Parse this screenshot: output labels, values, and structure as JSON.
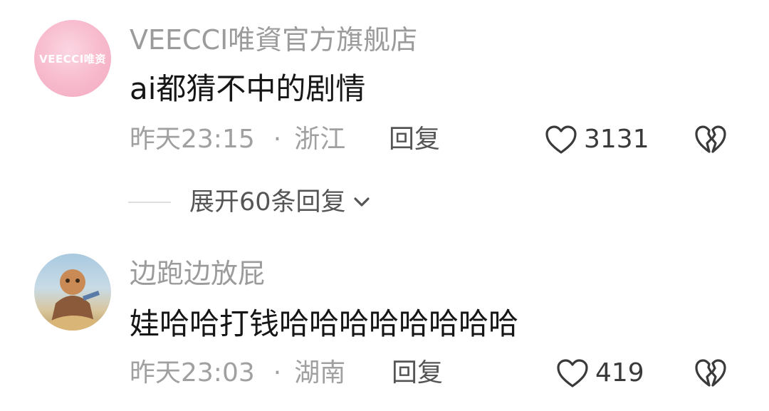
{
  "comments": [
    {
      "username": "VEECCI唯資官方旗舰店",
      "avatar_text": "VEECCI唯资",
      "text": "ai都猜不中的剧情",
      "time": "昨天23:15",
      "location": "浙江",
      "reply_label": "回复",
      "likes": "3131",
      "expand_label": "展开60条回复"
    },
    {
      "username": "边跑边放屁",
      "text": "娃哈哈打钱哈哈哈哈哈哈哈哈",
      "time": "昨天23:03",
      "location": "湖南",
      "reply_label": "回复",
      "likes": "419"
    }
  ],
  "meta_separator": "·",
  "icons": {
    "like": "heart-outline-icon",
    "dislike": "broken-heart-icon",
    "expand": "chevron-down-icon"
  },
  "colors": {
    "username": "#9b9b9b",
    "content": "#161616",
    "meta": "#a0a0a0",
    "action": "#555555",
    "avatar_pink": "#f7b9cc"
  }
}
